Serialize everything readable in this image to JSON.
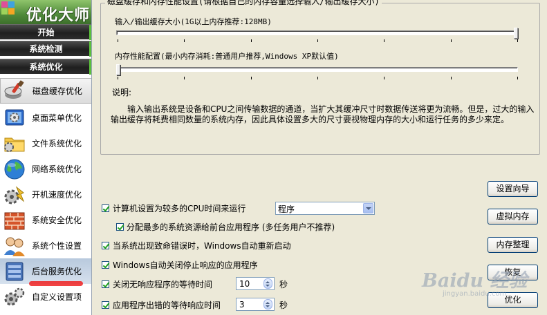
{
  "sidebar": {
    "logo_title": "优化大师",
    "sections": [
      "开始",
      "系统检测",
      "系统优化"
    ],
    "items": [
      {
        "label": "磁盘缓存优化",
        "icon": "disk-brush-icon"
      },
      {
        "label": "桌面菜单优化",
        "icon": "desktop-gear-icon"
      },
      {
        "label": "文件系统优化",
        "icon": "folder-gear-icon"
      },
      {
        "label": "网络系统优化",
        "icon": "globe-icon"
      },
      {
        "label": "开机速度优化",
        "icon": "speed-gear-icon"
      },
      {
        "label": "系统安全优化",
        "icon": "firewall-icon"
      },
      {
        "label": "系统个性设置",
        "icon": "users-icon"
      },
      {
        "label": "后台服务优化",
        "icon": "server-icon"
      },
      {
        "label": "自定义设置项",
        "icon": "gears-icon"
      }
    ]
  },
  "group": {
    "title": "磁盘缓存和内存性能设置(请根据自己的内存容量选择输入/输出缓存大小)",
    "io_label": "输入/输出缓存大小(1G以上内存推荐:128MB)",
    "io_level": 1.0,
    "mem_label": "内存性能配置(最小内存消耗:普通用户推荐,Windows XP默认值)",
    "mem_level": 0.0,
    "desc_title": "说明:",
    "desc_text": "　　输入输出系统是设备和CPU之间传输数据的通道，当扩大其缓冲尺寸时数据传送将更为流畅。但是，过大的输入输出缓存将耗费相同数量的系统内存，因此具体设置多大的尺寸要视物理内存的大小和运行任务的多少来定。"
  },
  "options": {
    "cpu_time": {
      "label": "计算机设置为较多的CPU时间来运行",
      "checked": true,
      "select_value": "程序"
    },
    "foreground": {
      "label": "分配最多的系统资源给前台应用程序 (多任务用户不推荐)",
      "checked": true
    },
    "auto_restart": {
      "label": "当系统出现致命错误时，Windows自动重新启动",
      "checked": true
    },
    "auto_close": {
      "label": "Windows自动关闭停止响应的应用程序",
      "checked": true
    },
    "close_wait": {
      "label": "关闭无响应程序的等待时间",
      "checked": true,
      "value": "10",
      "unit": "秒"
    },
    "error_wait": {
      "label": "应用程序出错的等待响应时间",
      "checked": true,
      "value": "3",
      "unit": "秒"
    }
  },
  "buttons": {
    "wizard": "设置向导",
    "virtual_memory": "虚拟内存",
    "memory_defrag": "内存整理",
    "restore": "恢复",
    "optimize": "优化"
  },
  "watermark": {
    "text": "Baidu 经验",
    "sub": "jingyan.baidu.com"
  }
}
